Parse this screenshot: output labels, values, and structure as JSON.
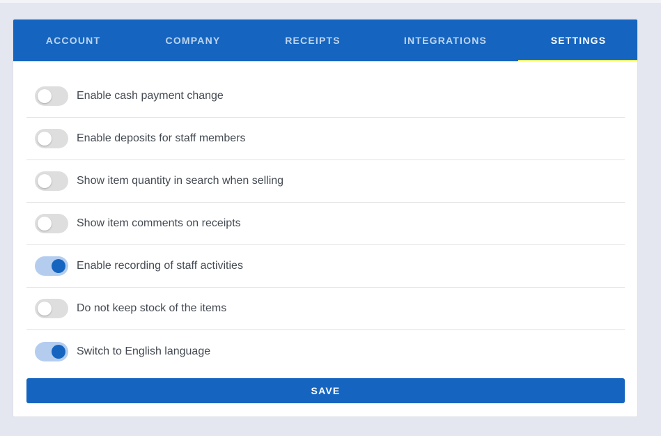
{
  "tabs": [
    {
      "label": "ACCOUNT",
      "active": false
    },
    {
      "label": "COMPANY",
      "active": false
    },
    {
      "label": "RECEIPTS",
      "active": false
    },
    {
      "label": "INTEGRATIONS",
      "active": false
    },
    {
      "label": "SETTINGS",
      "active": true
    }
  ],
  "settings": [
    {
      "label": "Enable cash payment change",
      "enabled": false
    },
    {
      "label": "Enable deposits for staff members",
      "enabled": false
    },
    {
      "label": "Show item quantity in search when selling",
      "enabled": false
    },
    {
      "label": "Show item comments on receipts",
      "enabled": false
    },
    {
      "label": "Enable recording of staff activities",
      "enabled": true
    },
    {
      "label": "Do not keep stock of the items",
      "enabled": false
    },
    {
      "label": "Switch to English language",
      "enabled": true
    }
  ],
  "save_label": "SAVE",
  "colors": {
    "primary": "#1565c0",
    "active_tab_indicator": "#e8f06a",
    "toggle_on_track": "#b4cdef",
    "toggle_off_track": "#dedede",
    "page_background": "#e4e7ef"
  }
}
